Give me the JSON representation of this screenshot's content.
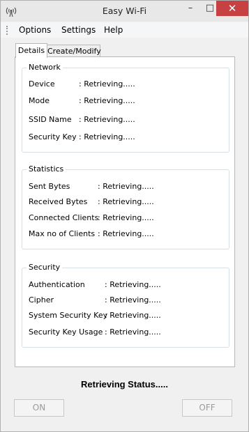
{
  "window": {
    "title": "Easy Wi-Fi",
    "minimize": "–",
    "maximize": "□",
    "close": "✕"
  },
  "menu": [
    "Options",
    "Settings",
    "Help"
  ],
  "tabs": {
    "details": "Details",
    "create": "Create/Modify"
  },
  "network": {
    "title": "Network",
    "rows": [
      {
        "label": "Device",
        "value": ": Retrieving....."
      },
      {
        "label": "Mode",
        "value": ": Retrieving....."
      },
      {
        "label": "SSID Name",
        "value": ": Retrieving....."
      },
      {
        "label": "Security Key",
        "value": ": Retrieving....."
      }
    ]
  },
  "statistics": {
    "title": "Statistics",
    "rows": [
      {
        "label": "Sent Bytes",
        "value": ": Retrieving....."
      },
      {
        "label": "Received Bytes",
        "value": ": Retrieving....."
      },
      {
        "label": "Connected Clients",
        "value": ": Retrieving....."
      },
      {
        "label": "Max no of Clients",
        "value": ": Retrieving....."
      }
    ]
  },
  "security": {
    "title": "Security",
    "rows": [
      {
        "label": "Authentication",
        "value": ": Retrieving....."
      },
      {
        "label": "Cipher",
        "value": ": Retrieving....."
      },
      {
        "label": "System Security Key",
        "value": ": Retrieving....."
      },
      {
        "label": "Security Key Usage",
        "value": ": Retrieving....."
      }
    ]
  },
  "status": "Retrieving Status.....",
  "buttons": {
    "on": "ON",
    "off": "OFF"
  }
}
